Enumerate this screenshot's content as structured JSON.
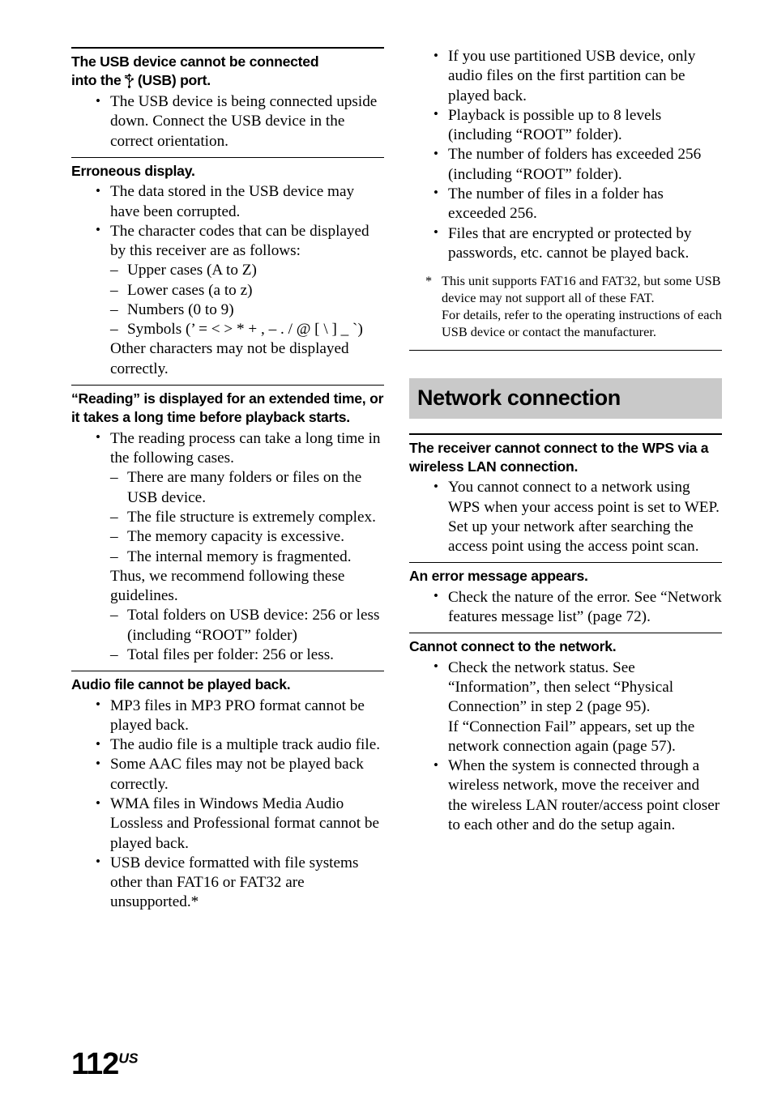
{
  "page": {
    "number": "112",
    "region_suffix": "US"
  },
  "left_column": {
    "sections": [
      {
        "heading_line1": "The USB device cannot be connected",
        "heading_line2_prefix": "into the",
        "heading_icon": "usb-icon",
        "heading_icon_glyph": "Ὗ",
        "heading_line2_suffix": "(USB) port.",
        "bullets": [
          "The USB device is being connected upside down. Connect the USB device in the correct orientation."
        ]
      },
      {
        "heading": "Erroneous display.",
        "bullets": [
          "The data stored in the USB device may have been corrupted."
        ],
        "bullet_with_sub": {
          "text": "The character codes that can be displayed by this receiver are as follows:",
          "sub_items": [
            "Upper cases (A to Z)",
            "Lower cases (a to z)",
            "Numbers (0 to 9)",
            "Symbols (’ = < > * + , – . / @ [ \\ ] _ `)"
          ],
          "trailing_text": "Other characters may not be displayed correctly."
        }
      },
      {
        "heading": "“Reading” is displayed for an extended time, or it takes a long time before playback starts.",
        "bullet_with_sub": {
          "text": "The reading process can take a long time in the following cases.",
          "sub_items_a": [
            "There are many folders or files on the USB device.",
            "The file structure is extremely complex.",
            "The memory capacity is excessive.",
            "The internal memory is fragmented."
          ],
          "middle_text": "Thus, we recommend following these guidelines.",
          "sub_items_b": [
            "Total folders on USB device: 256 or less (including “ROOT” folder)",
            "Total files per folder: 256 or less."
          ]
        }
      },
      {
        "heading": "Audio file cannot be played back.",
        "bullets": [
          "MP3 files in MP3 PRO format cannot be played back.",
          "The audio file is a multiple track audio file.",
          "Some AAC files may not be played back correctly.",
          "WMA files in Windows Media Audio Lossless and Professional format cannot be played back.",
          "USB device formatted with file systems other than FAT16 or FAT32 are unsupported.*"
        ]
      }
    ]
  },
  "right_column": {
    "continued_bullets": [
      "If you use partitioned USB device, only audio files on the first partition can be played back.",
      "Playback is possible up to 8 levels (including “ROOT” folder).",
      "The number of folders has exceeded 256 (including “ROOT” folder).",
      "The number of files in a folder has exceeded 256.",
      "Files that are encrypted or protected by passwords, etc. cannot be played back."
    ],
    "footnote": {
      "marker": "*",
      "paragraph1": "This unit supports FAT16 and FAT32, but some USB device may not support all of these FAT.",
      "paragraph2": "For details, refer to the operating instructions of each USB device or contact the manufacturer."
    },
    "section_banner": "Network connection",
    "sections": [
      {
        "heading": "The receiver cannot connect to the WPS via a wireless LAN connection.",
        "bullets": [
          "You cannot connect to a network using WPS when your access point is set to WEP. Set up your network after searching the access point using the access point scan."
        ]
      },
      {
        "heading": "An error message appears.",
        "bullets": [
          "Check the nature of the error. See “Network features message list” (page 72)."
        ]
      },
      {
        "heading": "Cannot connect to the network.",
        "bullet_multi": {
          "line1": "Check the network status. See “Information”, then select “Physical Connection” in step 2 (page 95).",
          "line2": "If “Connection Fail” appears, set up the network connection again (page 57)."
        },
        "bullets_after": [
          "When the system is connected through a wireless network, move the receiver and the wireless LAN router/access point closer to each other and do the setup again."
        ]
      }
    ]
  },
  "colors": {
    "banner_background": "#c9c9c9",
    "text": "#000000",
    "page_background": "#ffffff"
  }
}
